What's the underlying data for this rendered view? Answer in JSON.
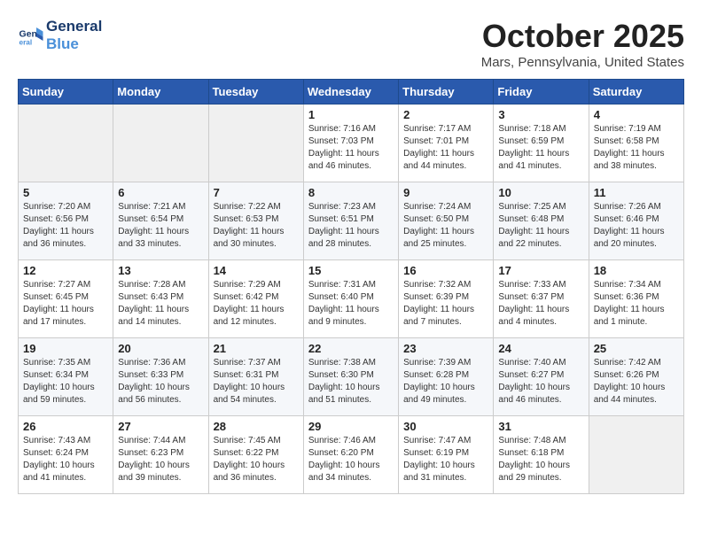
{
  "header": {
    "logo_line1": "General",
    "logo_line2": "Blue",
    "month": "October 2025",
    "location": "Mars, Pennsylvania, United States"
  },
  "weekdays": [
    "Sunday",
    "Monday",
    "Tuesday",
    "Wednesday",
    "Thursday",
    "Friday",
    "Saturday"
  ],
  "weeks": [
    [
      {
        "day": "",
        "info": ""
      },
      {
        "day": "",
        "info": ""
      },
      {
        "day": "",
        "info": ""
      },
      {
        "day": "1",
        "info": "Sunrise: 7:16 AM\nSunset: 7:03 PM\nDaylight: 11 hours\nand 46 minutes."
      },
      {
        "day": "2",
        "info": "Sunrise: 7:17 AM\nSunset: 7:01 PM\nDaylight: 11 hours\nand 44 minutes."
      },
      {
        "day": "3",
        "info": "Sunrise: 7:18 AM\nSunset: 6:59 PM\nDaylight: 11 hours\nand 41 minutes."
      },
      {
        "day": "4",
        "info": "Sunrise: 7:19 AM\nSunset: 6:58 PM\nDaylight: 11 hours\nand 38 minutes."
      }
    ],
    [
      {
        "day": "5",
        "info": "Sunrise: 7:20 AM\nSunset: 6:56 PM\nDaylight: 11 hours\nand 36 minutes."
      },
      {
        "day": "6",
        "info": "Sunrise: 7:21 AM\nSunset: 6:54 PM\nDaylight: 11 hours\nand 33 minutes."
      },
      {
        "day": "7",
        "info": "Sunrise: 7:22 AM\nSunset: 6:53 PM\nDaylight: 11 hours\nand 30 minutes."
      },
      {
        "day": "8",
        "info": "Sunrise: 7:23 AM\nSunset: 6:51 PM\nDaylight: 11 hours\nand 28 minutes."
      },
      {
        "day": "9",
        "info": "Sunrise: 7:24 AM\nSunset: 6:50 PM\nDaylight: 11 hours\nand 25 minutes."
      },
      {
        "day": "10",
        "info": "Sunrise: 7:25 AM\nSunset: 6:48 PM\nDaylight: 11 hours\nand 22 minutes."
      },
      {
        "day": "11",
        "info": "Sunrise: 7:26 AM\nSunset: 6:46 PM\nDaylight: 11 hours\nand 20 minutes."
      }
    ],
    [
      {
        "day": "12",
        "info": "Sunrise: 7:27 AM\nSunset: 6:45 PM\nDaylight: 11 hours\nand 17 minutes."
      },
      {
        "day": "13",
        "info": "Sunrise: 7:28 AM\nSunset: 6:43 PM\nDaylight: 11 hours\nand 14 minutes."
      },
      {
        "day": "14",
        "info": "Sunrise: 7:29 AM\nSunset: 6:42 PM\nDaylight: 11 hours\nand 12 minutes."
      },
      {
        "day": "15",
        "info": "Sunrise: 7:31 AM\nSunset: 6:40 PM\nDaylight: 11 hours\nand 9 minutes."
      },
      {
        "day": "16",
        "info": "Sunrise: 7:32 AM\nSunset: 6:39 PM\nDaylight: 11 hours\nand 7 minutes."
      },
      {
        "day": "17",
        "info": "Sunrise: 7:33 AM\nSunset: 6:37 PM\nDaylight: 11 hours\nand 4 minutes."
      },
      {
        "day": "18",
        "info": "Sunrise: 7:34 AM\nSunset: 6:36 PM\nDaylight: 11 hours\nand 1 minute."
      }
    ],
    [
      {
        "day": "19",
        "info": "Sunrise: 7:35 AM\nSunset: 6:34 PM\nDaylight: 10 hours\nand 59 minutes."
      },
      {
        "day": "20",
        "info": "Sunrise: 7:36 AM\nSunset: 6:33 PM\nDaylight: 10 hours\nand 56 minutes."
      },
      {
        "day": "21",
        "info": "Sunrise: 7:37 AM\nSunset: 6:31 PM\nDaylight: 10 hours\nand 54 minutes."
      },
      {
        "day": "22",
        "info": "Sunrise: 7:38 AM\nSunset: 6:30 PM\nDaylight: 10 hours\nand 51 minutes."
      },
      {
        "day": "23",
        "info": "Sunrise: 7:39 AM\nSunset: 6:28 PM\nDaylight: 10 hours\nand 49 minutes."
      },
      {
        "day": "24",
        "info": "Sunrise: 7:40 AM\nSunset: 6:27 PM\nDaylight: 10 hours\nand 46 minutes."
      },
      {
        "day": "25",
        "info": "Sunrise: 7:42 AM\nSunset: 6:26 PM\nDaylight: 10 hours\nand 44 minutes."
      }
    ],
    [
      {
        "day": "26",
        "info": "Sunrise: 7:43 AM\nSunset: 6:24 PM\nDaylight: 10 hours\nand 41 minutes."
      },
      {
        "day": "27",
        "info": "Sunrise: 7:44 AM\nSunset: 6:23 PM\nDaylight: 10 hours\nand 39 minutes."
      },
      {
        "day": "28",
        "info": "Sunrise: 7:45 AM\nSunset: 6:22 PM\nDaylight: 10 hours\nand 36 minutes."
      },
      {
        "day": "29",
        "info": "Sunrise: 7:46 AM\nSunset: 6:20 PM\nDaylight: 10 hours\nand 34 minutes."
      },
      {
        "day": "30",
        "info": "Sunrise: 7:47 AM\nSunset: 6:19 PM\nDaylight: 10 hours\nand 31 minutes."
      },
      {
        "day": "31",
        "info": "Sunrise: 7:48 AM\nSunset: 6:18 PM\nDaylight: 10 hours\nand 29 minutes."
      },
      {
        "day": "",
        "info": ""
      }
    ]
  ]
}
